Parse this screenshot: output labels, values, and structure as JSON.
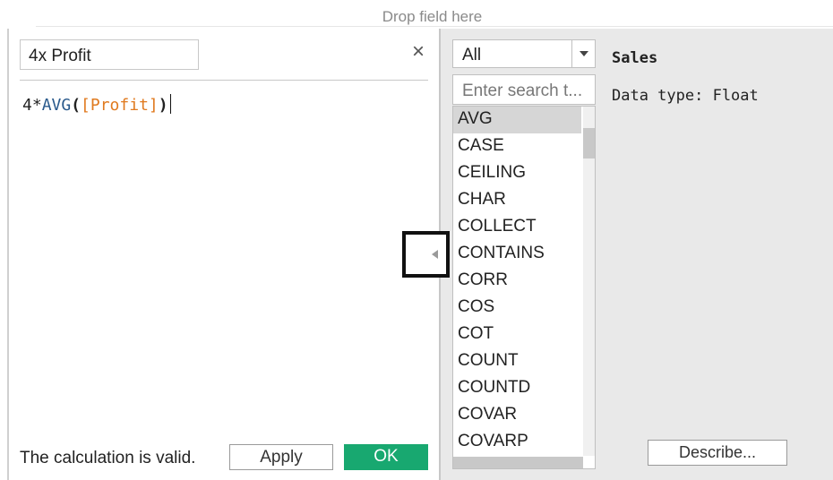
{
  "drop_zone": {
    "label": "Drop field here"
  },
  "editor": {
    "calc_name": "4x Profit",
    "close_glyph": "×",
    "formula": {
      "multiplier": "4*",
      "function": "AVG",
      "open_paren": "(",
      "field": "[Profit]",
      "close_paren": ")"
    },
    "status": "The calculation is valid.",
    "apply_label": "Apply",
    "ok_label": "OK"
  },
  "function_panel": {
    "category_selected": "All",
    "search_placeholder": "Enter search t...",
    "selected_function": "AVG",
    "functions": [
      "AVG",
      "CASE",
      "CEILING",
      "CHAR",
      "COLLECT",
      "CONTAINS",
      "CORR",
      "COS",
      "COT",
      "COUNT",
      "COUNTD",
      "COVAR",
      "COVARP"
    ]
  },
  "info_panel": {
    "field_name": "Sales",
    "data_type": "Data type: Float",
    "describe_label": "Describe..."
  },
  "colors": {
    "ok_button": "#18a870",
    "function_color": "#2a5a8c",
    "field_color": "#e07a1f",
    "panel_bg": "#e9e9e9"
  },
  "icons": {
    "close": "close-icon",
    "collapse": "chevron-left-icon",
    "dropdown": "chevron-down-icon"
  }
}
